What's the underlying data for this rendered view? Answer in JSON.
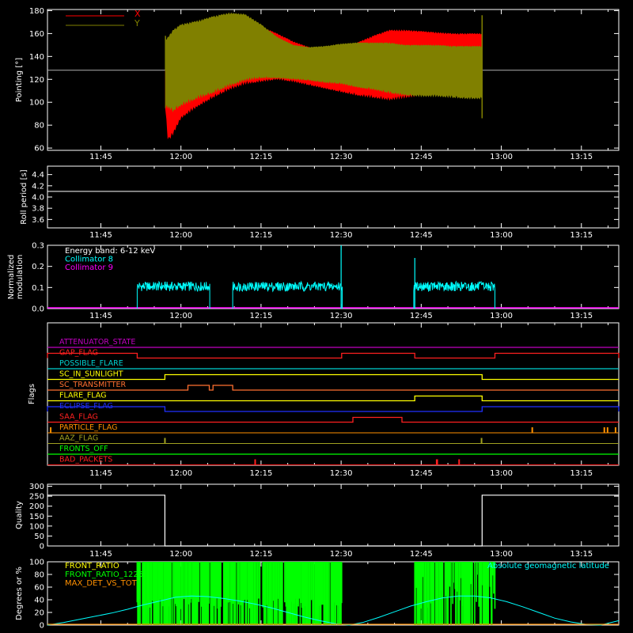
{
  "time_axis": {
    "tick_labels": [
      "11:45",
      "12:00",
      "12:15",
      "12:30",
      "12:45",
      "13:00",
      "13:15"
    ],
    "tick_minutes": [
      705,
      720,
      735,
      750,
      765,
      780,
      795
    ],
    "range_minutes": [
      695,
      802
    ]
  },
  "chart_data": [
    {
      "id": "pointing",
      "type": "area",
      "ylabel": "Pointing [°]",
      "ylim": [
        58,
        181
      ],
      "yticks": [
        60,
        80,
        100,
        120,
        140,
        160,
        180
      ],
      "reference_line": 128,
      "legend": [
        {
          "name": "X",
          "color": "#ff0000"
        },
        {
          "name": "Y",
          "color": "#808000"
        }
      ],
      "series": [
        {
          "name": "X",
          "color": "#ff0000",
          "x_minutes": [
            717.1,
            717.6,
            718.5,
            720,
            723,
            726,
            729,
            732,
            735,
            738,
            741,
            744,
            747,
            750,
            753,
            756,
            759,
            762,
            765,
            768,
            771,
            774,
            776.4
          ],
          "upper": [
            150,
            146,
            146,
            149,
            156,
            163,
            170,
            172,
            166,
            160,
            153,
            148,
            146,
            146,
            152,
            158,
            163,
            163,
            162,
            161,
            160,
            160,
            160
          ],
          "lower": [
            95,
            66,
            72,
            86,
            96,
            104,
            111,
            116,
            118,
            120,
            118,
            115,
            112,
            109,
            106,
            104,
            102,
            104,
            106,
            106,
            107,
            108,
            109
          ]
        },
        {
          "name": "Y",
          "color": "#808000",
          "x_minutes": [
            717.1,
            717.6,
            718.5,
            720,
            723,
            726,
            729,
            732,
            735,
            738,
            741,
            744,
            747,
            750,
            753,
            756,
            759,
            762,
            765,
            768,
            771,
            774,
            776.4
          ],
          "upper": [
            155,
            157,
            163,
            168,
            171,
            175,
            178,
            177,
            168,
            157,
            150,
            148,
            149,
            151,
            152,
            152,
            152,
            150,
            150,
            150,
            149,
            149,
            149
          ],
          "lower": [
            95,
            95,
            92,
            97,
            103,
            108,
            114,
            119,
            121,
            121,
            120,
            119,
            117,
            116,
            113,
            111,
            108,
            106,
            105,
            105,
            104,
            103,
            103
          ]
        }
      ]
    },
    {
      "id": "roll",
      "type": "line",
      "ylabel": "Roll period [s]",
      "ylim": [
        3.45,
        4.55
      ],
      "yticks": [
        3.6,
        3.8,
        4.0,
        4.2,
        4.4
      ],
      "ytick_labels": [
        "3.6",
        "3.8",
        "4.0",
        "4.2",
        "4.4"
      ],
      "series": [
        {
          "name": "",
          "color": "#ffffff",
          "x_minutes": [
            695,
            802
          ],
          "values": [
            4.1,
            4.1
          ]
        }
      ]
    },
    {
      "id": "modulation",
      "type": "line",
      "ylabel": [
        "Normalized",
        "modulation"
      ],
      "ylim": [
        0,
        0.3
      ],
      "yticks": [
        0.0,
        0.1,
        0.2,
        0.3
      ],
      "ytick_labels": [
        "0.0",
        "0.1",
        "0.2",
        "0.3"
      ],
      "legend": [
        {
          "name": "Energy band: 6-12 keV",
          "color": "#ffffff"
        },
        {
          "name": "Collimator 8",
          "color": "#00ffff"
        },
        {
          "name": "Collimator 9",
          "color": "#ff00ff"
        }
      ],
      "series": [
        {
          "name": "Collimator 8",
          "color": "#00ffff",
          "intervals": [
            [
              711.8,
              725.4
            ],
            [
              729.7,
              750.2
            ],
            [
              763.6,
              778.8
            ]
          ],
          "level": 0.105,
          "spikes": [
            [
              750.0,
              0.31
            ],
            [
              763.8,
              0.24
            ]
          ]
        },
        {
          "name": "Collimator 9",
          "color": "#ff00ff",
          "x_minutes": [
            695,
            802
          ],
          "values": [
            0.0,
            0.0
          ]
        }
      ]
    },
    {
      "id": "flags",
      "type": "line",
      "ylabel": "Flags",
      "rows": [
        {
          "label": "ATTENUATOR_STATE",
          "color": "#c000c0",
          "segments": []
        },
        {
          "label": "GAP_FLAG",
          "color": "#ff2020",
          "segments": [
            [
              695,
              711.8
            ],
            [
              750.1,
              763.8
            ],
            [
              778.8,
              802
            ]
          ]
        },
        {
          "label": "POSSIBLE_FLARE",
          "color": "#00d0d0",
          "segments": []
        },
        {
          "label": "SC_IN_SUNLIGHT",
          "color": "#ffff00",
          "segments": [
            [
              717.0,
              776.4
            ]
          ]
        },
        {
          "label": "SC_TRANSMITTER",
          "color": "#ff7030",
          "segments": [
            [
              721.3,
              725.3
            ],
            [
              726.0,
              729.7
            ]
          ]
        },
        {
          "label": "FLARE_FLAG",
          "color": "#ffff00",
          "segments": [
            [
              763.8,
              776.4
            ]
          ]
        },
        {
          "label": "ECLIPSE_FLAG",
          "color": "#2030ff",
          "segments": [
            [
              695,
              717.0
            ],
            [
              776.4,
              802
            ]
          ]
        },
        {
          "label": "SAA_FLAG",
          "color": "#ff2020",
          "segments": [
            [
              752.2,
              761.4
            ]
          ]
        },
        {
          "label": "PARTICLE_FLAG",
          "color": "#ff9000",
          "spikes": [
            695.6,
            785.8,
            799.3,
            799.9,
            801.4
          ]
        },
        {
          "label": "AAZ_FLAG",
          "color": "#a0a020",
          "spikes": [
            717.0,
            776.3
          ]
        },
        {
          "label": "FRONTS_OFF",
          "color": "#00ff00",
          "segments": []
        },
        {
          "label": "BAD_PACKETS",
          "color": "#ff2020",
          "spikes": [
            733.9,
            767.9,
            768.0,
            772.1
          ]
        }
      ]
    },
    {
      "id": "quality",
      "type": "line",
      "ylabel": "Quality",
      "ylim": [
        0,
        310
      ],
      "yticks": [
        0,
        50,
        100,
        150,
        200,
        250,
        300
      ],
      "series": [
        {
          "name": "",
          "color": "#ffffff",
          "segments": [
            [
              695,
              717.0,
              255
            ],
            [
              717.0,
              776.4,
              0
            ],
            [
              776.4,
              802,
              255
            ]
          ],
          "spikes": [
            [
              733.8,
              12
            ]
          ]
        }
      ]
    },
    {
      "id": "ratios",
      "type": "area",
      "ylabel": "Degrees or %",
      "ylim": [
        0,
        100
      ],
      "yticks": [
        0,
        20,
        40,
        60,
        80,
        100
      ],
      "legend": [
        {
          "name": "FRONT_RATIO",
          "color": "#ffff00"
        },
        {
          "name": "FRONT_RATIO_1225",
          "color": "#00ff00"
        },
        {
          "name": "MAX_DET_VS_TOT",
          "color": "#ff9000"
        },
        {
          "name": "Absolute geomagnetic latitude",
          "color": "#00ffff"
        }
      ],
      "series": [
        {
          "name": "FRONT_RATIO_1225",
          "color": "#00ff00",
          "intervals": [
            [
              711.8,
              750.1
            ],
            [
              763.8,
              778.8
            ]
          ]
        },
        {
          "name": "Absolute geomagnetic latitude",
          "color": "#00ffff",
          "x_minutes": [
            695,
            698,
            701,
            704,
            707,
            710,
            713,
            716,
            719,
            722,
            725,
            728,
            731,
            734,
            737,
            740,
            743,
            746,
            749,
            751.5,
            754,
            757,
            760,
            763,
            766,
            769,
            772,
            775,
            778,
            781,
            784,
            787,
            790,
            793,
            796,
            798.6,
            802
          ],
          "values": [
            0,
            4,
            9,
            14,
            19,
            25,
            32,
            38,
            44,
            46,
            45,
            42,
            38,
            33,
            27,
            20,
            13,
            7,
            2,
            0,
            4,
            12,
            21,
            30,
            37,
            43,
            46,
            46,
            43,
            37,
            29,
            20,
            11,
            5,
            1,
            0,
            7
          ]
        }
      ]
    }
  ]
}
